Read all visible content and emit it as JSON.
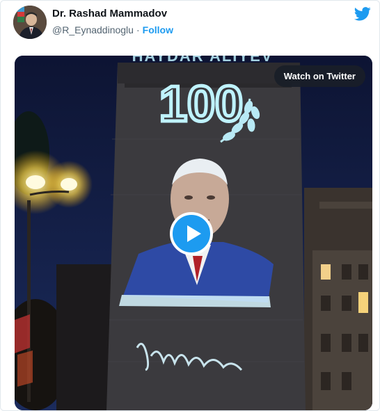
{
  "tweet": {
    "author_name": "Dr. Rashad Mammadov",
    "handle": "@R_Eynaddinoglu",
    "separator": "·",
    "follow_label": "Follow",
    "watch_label": "Watch on Twitter",
    "icons": {
      "brand": "twitter-bird-icon",
      "play": "play-icon"
    }
  },
  "projection": {
    "top_text": "HAYDAR ALIYEV",
    "number": "100"
  },
  "colors": {
    "accent": "#1d9bf0",
    "projection": "#bff3ff",
    "sky": "#121b3d"
  }
}
